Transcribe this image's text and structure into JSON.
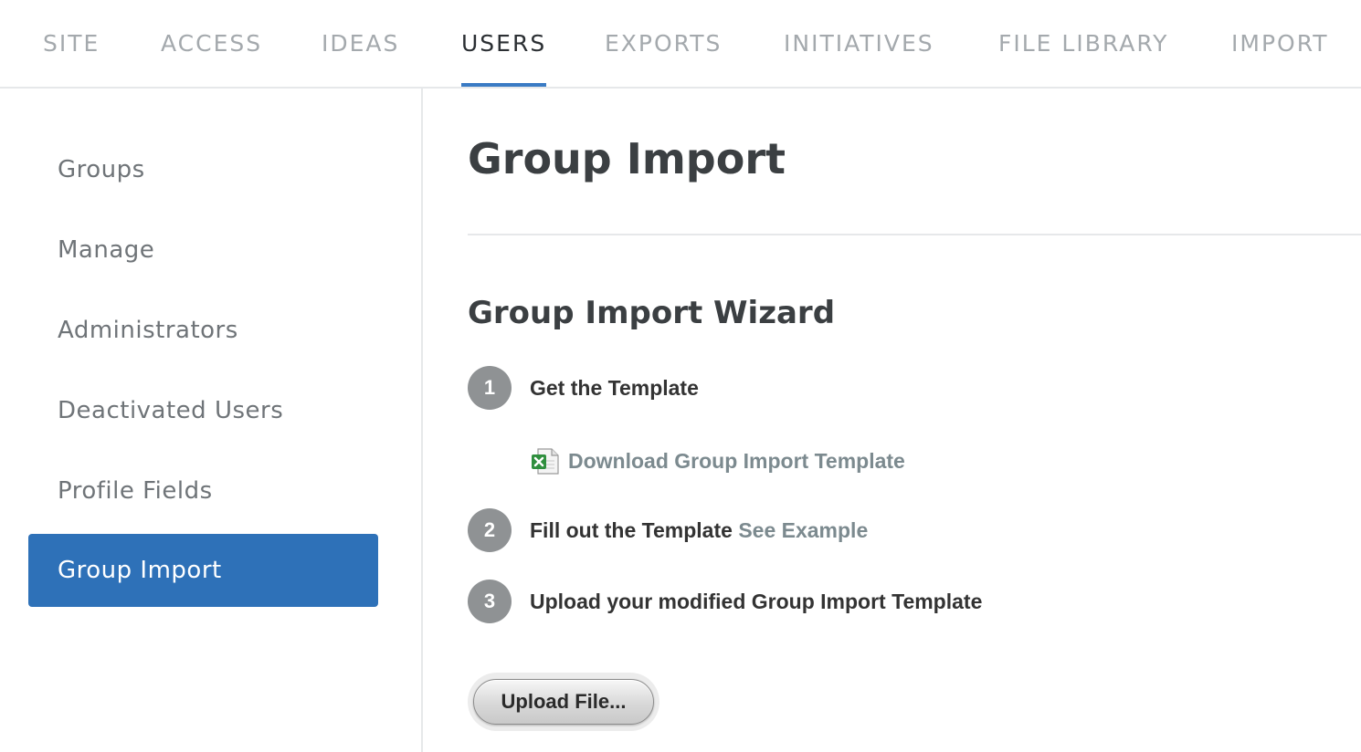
{
  "topnav": {
    "tabs": [
      {
        "label": "SITE"
      },
      {
        "label": "ACCESS"
      },
      {
        "label": "IDEAS"
      },
      {
        "label": "USERS"
      },
      {
        "label": "EXPORTS"
      },
      {
        "label": "INITIATIVES"
      },
      {
        "label": "FILE LIBRARY"
      },
      {
        "label": "IMPORT"
      }
    ],
    "active_tab": "USERS"
  },
  "sidebar": {
    "items": [
      {
        "label": "Groups"
      },
      {
        "label": "Manage"
      },
      {
        "label": "Administrators"
      },
      {
        "label": "Deactivated Users"
      },
      {
        "label": "Profile Fields"
      },
      {
        "label": "Group Import"
      }
    ],
    "active_item": "Group Import"
  },
  "main": {
    "title": "Group Import",
    "wizard_title": "Group Import Wizard",
    "steps": [
      {
        "number": "1",
        "text": "Get the Template"
      },
      {
        "number": "2",
        "text": "Fill out the Template",
        "link": "See Example"
      },
      {
        "number": "3",
        "text": "Upload your modified Group Import Template"
      }
    ],
    "download_link": "Download Group Import Template",
    "download_icon": "excel-file-icon",
    "upload_button": "Upload File..."
  },
  "colors": {
    "accent": "#3a7bc4",
    "sidebar_active": "#2e71b8",
    "step_circle": "#8f9294",
    "link": "#7c8a8f",
    "tab_inactive": "#a4a9ad"
  }
}
